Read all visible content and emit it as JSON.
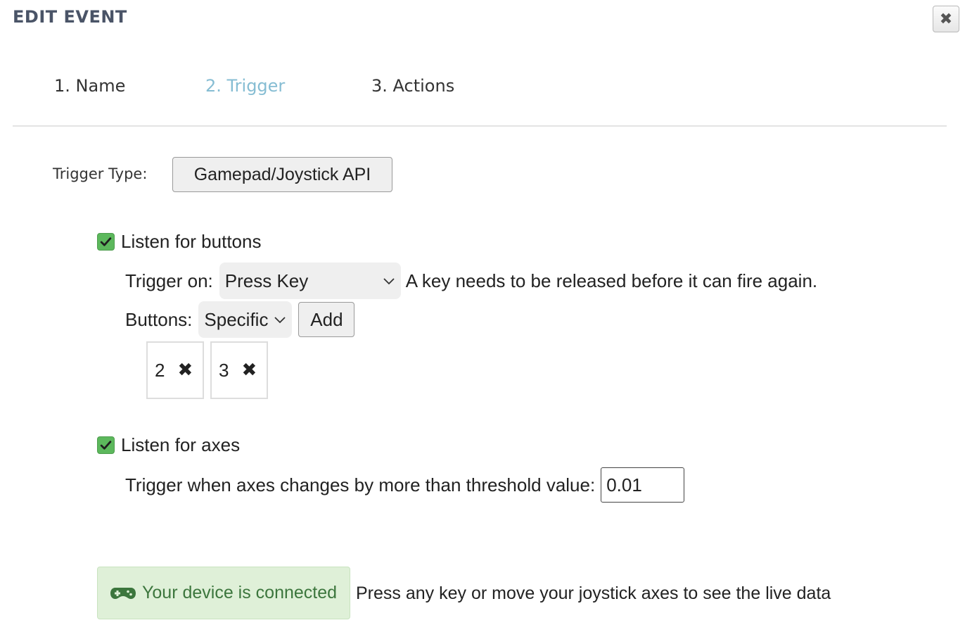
{
  "dialog": {
    "title": "EDIT EVENT",
    "close_icon": "close-icon"
  },
  "steps": [
    {
      "label": "1. Name",
      "active": false
    },
    {
      "label": "2. Trigger",
      "active": true
    },
    {
      "label": "3. Actions",
      "active": false
    }
  ],
  "trigger_type": {
    "label": "Trigger Type:",
    "value": "Gamepad/Joystick API"
  },
  "buttons_section": {
    "checkbox_label": "Listen for buttons",
    "checked": true,
    "trigger_on_label": "Trigger on:",
    "trigger_on_value": "Press Key",
    "trigger_on_hint": "A key needs to be released before it can fire again.",
    "buttons_label": "Buttons:",
    "buttons_mode": "Specific",
    "add_label": "Add",
    "selected_buttons": [
      "2",
      "3"
    ]
  },
  "axes_section": {
    "checkbox_label": "Listen for axes",
    "checked": true,
    "threshold_label": "Trigger when axes changes by more than threshold value:",
    "threshold_value": "0.01"
  },
  "status": {
    "badge_text": "Your device is connected",
    "icon": "gamepad-icon",
    "hint": "Press any key or move your joystick axes to see the live data",
    "colors": {
      "bg": "#dff0d8",
      "text": "#3c763d"
    }
  },
  "colors": {
    "active_step": "#86bdd3",
    "checkbox": "#5cb85c",
    "title": "#4a5467"
  }
}
